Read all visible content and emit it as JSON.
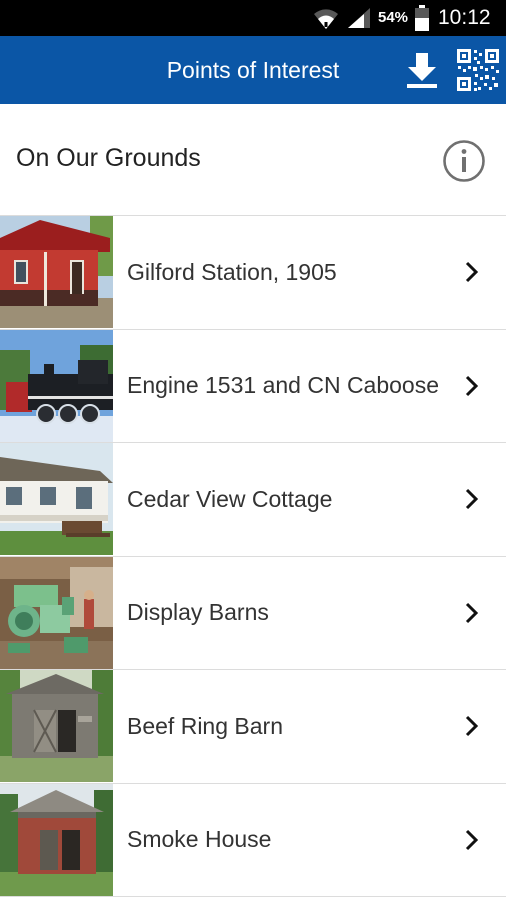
{
  "status_bar": {
    "battery_percent": "54%",
    "time": "10:12",
    "icons": [
      "wifi-icon",
      "signal-icon",
      "battery-icon"
    ]
  },
  "app_bar": {
    "title": "Points of Interest",
    "actions": [
      "download-icon",
      "qr-code-icon"
    ],
    "background_color": "#0b56a6"
  },
  "section": {
    "title": "On Our Grounds",
    "info_icon": "info-icon"
  },
  "items": [
    {
      "label": "Gilford Station, 1905",
      "thumbnail": "red-station-building"
    },
    {
      "label": "Engine 1531 and CN Caboose",
      "thumbnail": "steam-locomotive"
    },
    {
      "label": "Cedar View Cottage",
      "thumbnail": "white-cottage"
    },
    {
      "label": "Display Barns",
      "thumbnail": "farm-machinery"
    },
    {
      "label": "Beef Ring Barn",
      "thumbnail": "wooden-barn"
    },
    {
      "label": "Smoke House",
      "thumbnail": "brick-smoke-house"
    }
  ]
}
